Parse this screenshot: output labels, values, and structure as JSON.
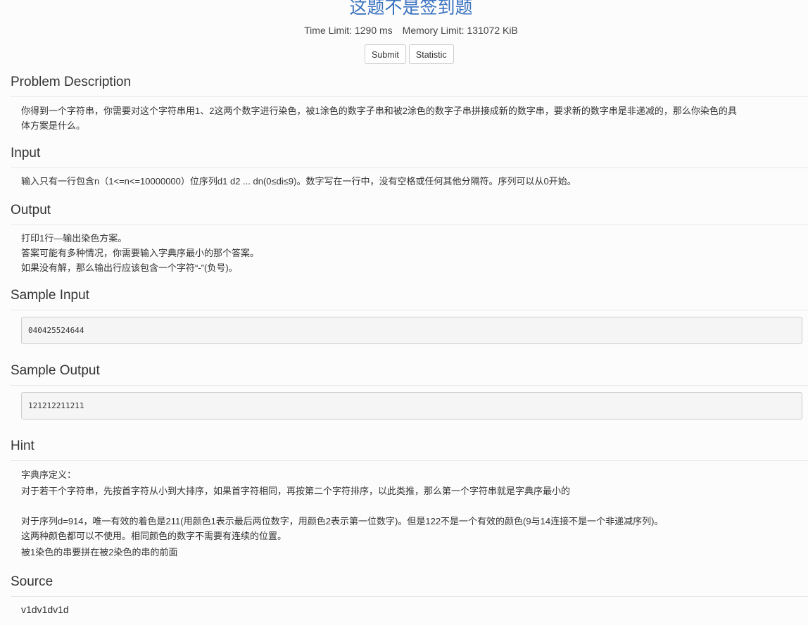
{
  "header": {
    "title": "这题不是签到题",
    "time_limit": "Time Limit: 1290 ms",
    "memory_limit": "Memory Limit: 131072 KiB",
    "submit_label": "Submit",
    "statistic_label": "Statistic"
  },
  "description": {
    "heading": "Problem Description",
    "line1": "你得到一个字符串，你需要对这个字符串用1、2这两个数字进行染色，被1涂色的数字子串和被2涂色的数字子串拼接成新的数字串，要求新的数字串是非递减的，那么你染色的具",
    "line2": "体方案是什么。"
  },
  "input": {
    "heading": "Input",
    "text": "输入只有一行包含n（1<=n<=10000000）位序列d1 d2 ... dn(0≤di≤9)。数字写在一行中，没有空格或任何其他分隔符。序列可以从0开始。"
  },
  "output": {
    "heading": "Output",
    "line1": "打印1行—输出染色方案。",
    "line2": "答案可能有多种情况，你需要输入字典序最小的那个答案。",
    "line3": "如果没有解，那么输出行应该包含一个字符“-”(负号)。"
  },
  "sample_input": {
    "heading": "Sample Input",
    "value": "040425524644"
  },
  "sample_output": {
    "heading": "Sample Output",
    "value": "121212211211"
  },
  "hint": {
    "heading": "Hint",
    "line1": "字典序定义：",
    "line2": "对于若干个字符串，先按首字符从小到大排序，如果首字符相同，再按第二个字符排序，以此类推，那么第一个字符串就是字典序最小的",
    "line3": "对于序列d=914，唯一有效的着色是211(用颜色1表示最后两位数字，用颜色2表示第一位数字)。但是122不是一个有效的颜色(9与14连接不是一个非递减序列)。",
    "line4": "这两种颜色都可以不使用。相同颜色的数字不需要有连续的位置。",
    "line5": "被1染色的串要拼在被2染色的串的前面"
  },
  "source": {
    "heading": "Source",
    "value": "v1dv1dv1d"
  }
}
